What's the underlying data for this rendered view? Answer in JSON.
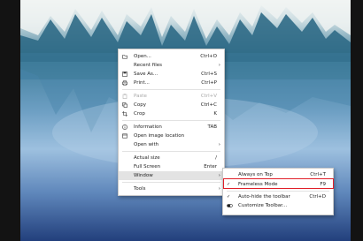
{
  "menu": {
    "items": [
      {
        "label": "Open...",
        "shortcut": "Ctrl+O",
        "icon": "folder-icon",
        "arrow": "",
        "disabled": false
      },
      {
        "label": "Recent files",
        "shortcut": "",
        "icon": "",
        "arrow": "›",
        "disabled": false
      },
      {
        "label": "Save As...",
        "shortcut": "Ctrl+S",
        "icon": "save-icon",
        "arrow": "",
        "disabled": false
      },
      {
        "label": "Print...",
        "shortcut": "Ctrl+P",
        "icon": "print-icon",
        "arrow": "",
        "disabled": false
      },
      {
        "label": "Paste",
        "shortcut": "Ctrl+V",
        "icon": "paste-icon",
        "arrow": "",
        "disabled": true
      },
      {
        "label": "Copy",
        "shortcut": "Ctrl+C",
        "icon": "copy-icon",
        "arrow": "",
        "disabled": false
      },
      {
        "label": "Crop",
        "shortcut": "K",
        "icon": "crop-icon",
        "arrow": "",
        "disabled": false
      },
      {
        "label": "Information",
        "shortcut": "TAB",
        "icon": "info-icon",
        "arrow": "",
        "disabled": false
      },
      {
        "label": "Open image location",
        "shortcut": "",
        "icon": "location-icon",
        "arrow": "",
        "disabled": false
      },
      {
        "label": "Open with",
        "shortcut": "",
        "icon": "",
        "arrow": "›",
        "disabled": false
      },
      {
        "label": "Actual size",
        "shortcut": "/",
        "icon": "",
        "arrow": "",
        "disabled": false
      },
      {
        "label": "Full Screen",
        "shortcut": "Enter",
        "icon": "",
        "arrow": "",
        "disabled": false
      },
      {
        "label": "Window",
        "shortcut": "",
        "icon": "",
        "arrow": "›",
        "disabled": false,
        "highlighted": true
      },
      {
        "label": "Tools",
        "shortcut": "",
        "icon": "",
        "arrow": "›",
        "disabled": false
      }
    ]
  },
  "submenu": {
    "items": [
      {
        "label": "Always on Top",
        "shortcut": "Ctrl+T",
        "checked": false
      },
      {
        "label": "Frameless Mode",
        "shortcut": "F9",
        "checked": true
      },
      {
        "label": "Auto-hide the toolbar",
        "shortcut": "Ctrl+D",
        "checked": true
      },
      {
        "label": "Customize Toolbar...",
        "shortcut": "",
        "checked": false,
        "icon": "toggle-icon"
      }
    ],
    "check_glyph": "✓"
  },
  "highlight_color": "#e0202a"
}
